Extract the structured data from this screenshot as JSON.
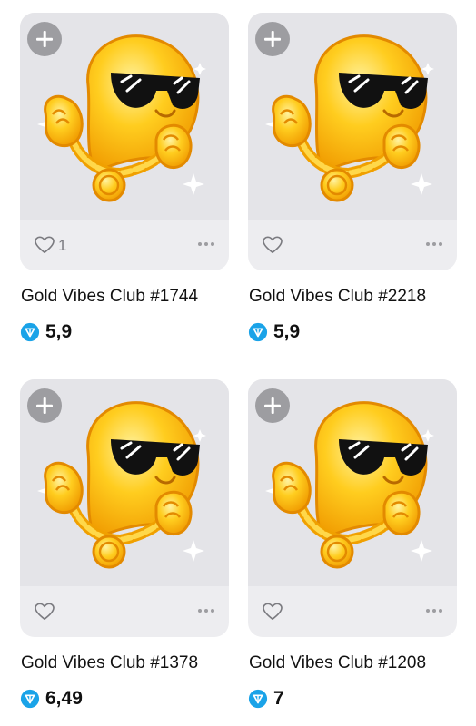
{
  "items": [
    {
      "title": "Gold Vibes Club #1744",
      "price": "5,9",
      "likes": "1",
      "liked_count_shown": true
    },
    {
      "title": "Gold Vibes Club #2218",
      "price": "5,9",
      "likes": "",
      "liked_count_shown": false
    },
    {
      "title": "Gold Vibes Club #1378",
      "price": "6,49",
      "likes": "",
      "liked_count_shown": false
    },
    {
      "title": "Gold Vibes Club #1208",
      "price": "7",
      "likes": "",
      "liked_count_shown": false
    }
  ],
  "icons": {
    "add": "plus-icon",
    "like": "heart-icon",
    "more": "more-dots-icon",
    "currency": "ton-diamond-icon"
  },
  "colors": {
    "card_bg": "#ededf0",
    "ton_blue": "#1aa3e8",
    "gold": "#ffc21a",
    "gold_dark": "#e89a00"
  }
}
